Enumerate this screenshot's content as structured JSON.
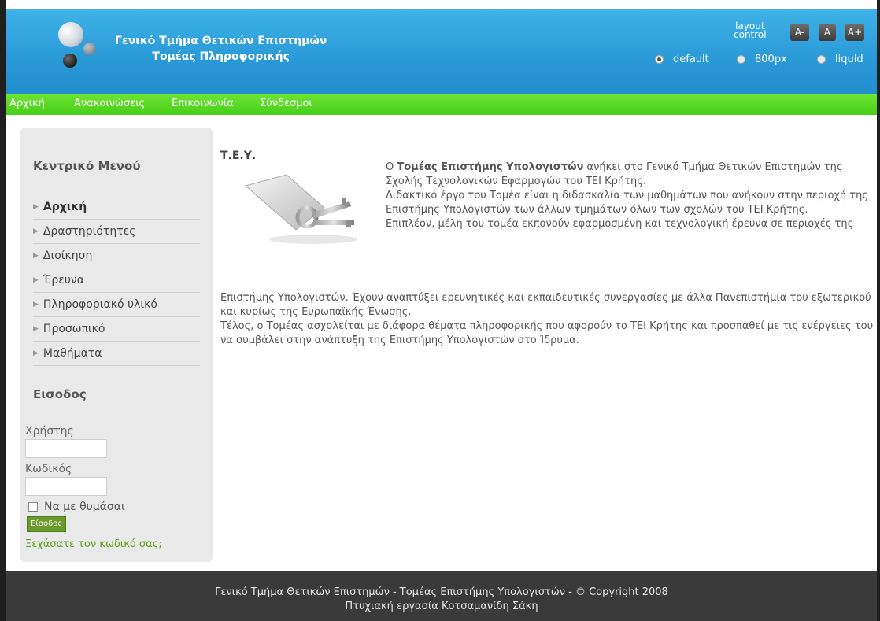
{
  "header": {
    "title_line1": "Γενικό Τμήμα Θετικών Επιστημών",
    "title_line2": "Τομέας Πληροφορικής",
    "layout_control_label": "layout control",
    "size_buttons": [
      "A-",
      "A",
      "A+"
    ],
    "layout_options": [
      "default",
      "800px",
      "liquid"
    ],
    "selected_layout": "default"
  },
  "navbar": {
    "items": [
      "Αρχική",
      "Ανακοινώσεις",
      "Επικοινωνία",
      "Σύνδεσμοι"
    ]
  },
  "sidebar": {
    "menu_heading": "Κεντρικό Μενού",
    "menu_items": [
      "Αρχική",
      "Δραστηριότητες",
      "Διοίκηση",
      "Έρευνα",
      "Πληροφοριακό υλικό",
      "Προσωπικό",
      "Μαθήματα"
    ],
    "active_item": "Αρχική",
    "login_heading": "Εισοδος",
    "username_label": "Χρήστης",
    "password_label": "Κωδικός",
    "remember_label": "Να με θυμάσαι",
    "login_button": "Είσοδος",
    "forgot_link": "Ξεχάσατε τον κωδικό σας;"
  },
  "content": {
    "title": "Τ.Ε.Υ.",
    "intro_pre": "Ο ",
    "intro_bold": "Τομέας Επιστήμης Υπολογιστών",
    "intro_post": " ανήκει στο Γενικό Τμήμα Θετικών Επιστημών της Σχολής Τεχνολογικών Εφαρμογών του ΤΕΙ Κρήτης.",
    "para2": "Διδακτικό έργο του Τομέα είναι η διδασκαλία των μαθημάτων που ανήκουν στην περιοχή της Επιστήμης Υπολογιστών των άλλων τμημάτων όλων των σχολών του ΤΕΙ Κρήτης.",
    "para3": "Επιπλέον, μέλη του τομέα εκπονούν εφαρμοσμένη και τεχνολογική έρευνα σε περιοχές της",
    "para4": "Επιστήμης Υπολογιστών. Έχουν αναπτύξει ερευνητικές και εκπαιδευτικές συνεργασίες με άλλα Πανεπιστήμια του εξωτερικού και κυρίως της Ευρωπαϊκής Ένωσης.",
    "para5": "Τέλος, ο Τομέας ασχολείται με διάφορα θέματα πληροφορικής που αφορούν το ΤΕΙ Κρήτης και προσπαθεί με τις ενέργειες του να συμβάλει στην ανάπτυξη της Επιστήμης Υπολογιστών στο Ίδρυμα."
  },
  "footer": {
    "line1": "Γενικό Τμήμα Θετικών Επιστημών - Τομέας Επιστήμης Υπολογιστών - © Copyright 2008",
    "line2": "Πτυχιακή εργασία Κοτσαμανίδη Σάκη"
  },
  "colors": {
    "header_blue": "#2b9bd8",
    "nav_green": "#4ed21b",
    "footer_dark": "#3a3a3a",
    "link_green": "#5aa216"
  }
}
